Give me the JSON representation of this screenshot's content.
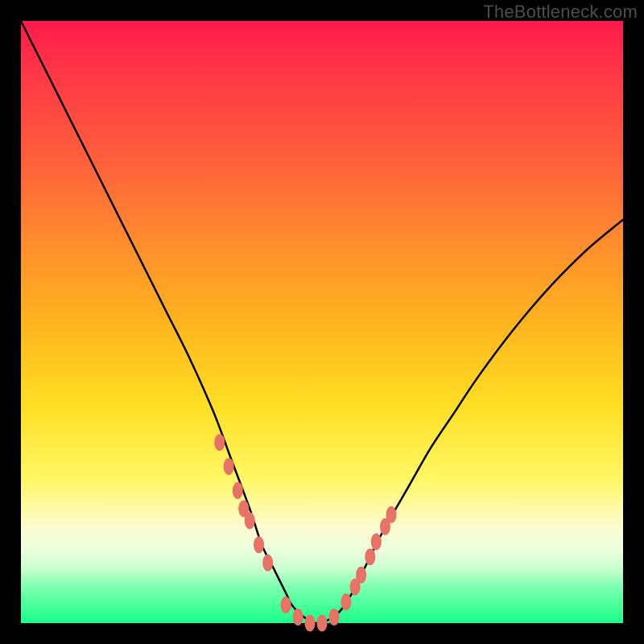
{
  "watermark": "TheBottleneck.com",
  "chart_data": {
    "type": "line",
    "title": "",
    "xlabel": "",
    "ylabel": "",
    "xlim": [
      0,
      100
    ],
    "ylim": [
      0,
      100
    ],
    "curve": {
      "x": [
        0,
        4,
        8,
        12,
        16,
        20,
        24,
        28,
        32,
        35,
        38,
        40,
        42,
        44,
        45,
        47,
        49,
        51,
        53,
        55,
        57,
        60,
        64,
        68,
        72,
        76,
        82,
        88,
        94,
        100
      ],
      "y": [
        100,
        92,
        84,
        76,
        68,
        60,
        52,
        44,
        35,
        27,
        19,
        13,
        9,
        5,
        3,
        1,
        0,
        0.5,
        2,
        5,
        9,
        15,
        22,
        29,
        35,
        41,
        49,
        56,
        62,
        67
      ]
    },
    "markers": {
      "x": [
        33,
        34.5,
        36,
        37,
        38,
        39.5,
        41,
        44,
        46,
        48,
        50,
        52,
        54,
        55.5,
        56.5,
        58,
        59,
        60.5,
        61.5
      ],
      "y": [
        30,
        26,
        22,
        19,
        17,
        13,
        10,
        3,
        1,
        0,
        0,
        1,
        3.5,
        6,
        8,
        11,
        13.5,
        16,
        18
      ]
    },
    "colors": {
      "curve": "#000000",
      "markers": "#e77366",
      "gradient_top": "#ff1a4d",
      "gradient_bottom": "#18ff88"
    }
  }
}
